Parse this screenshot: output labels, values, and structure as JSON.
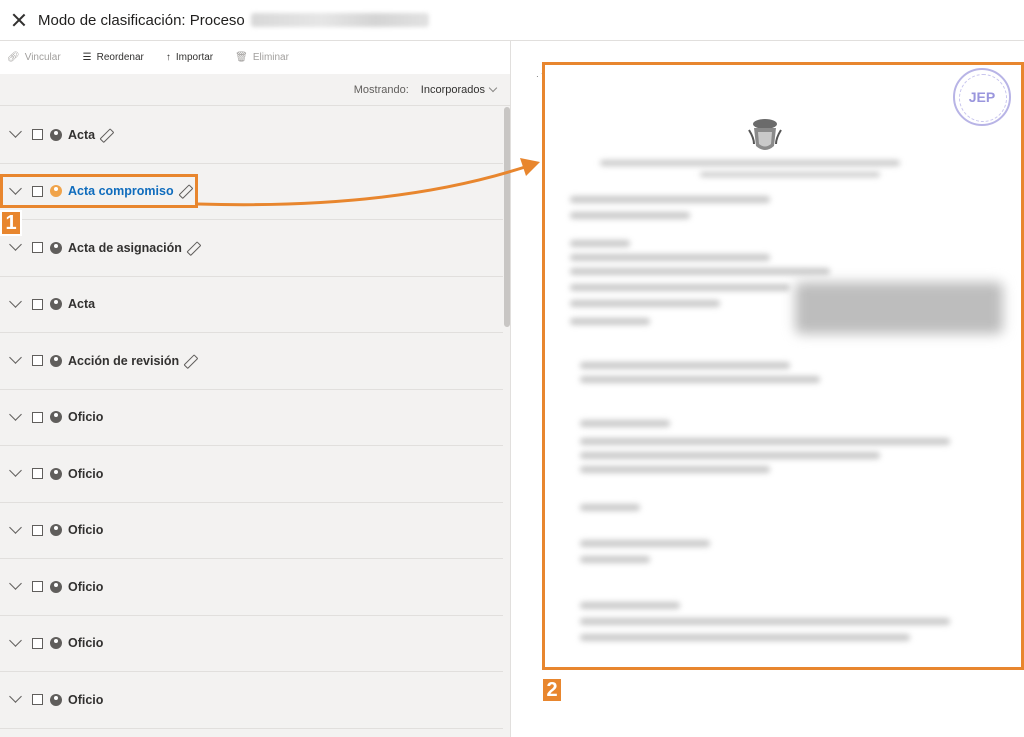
{
  "header": {
    "title": "Modo de clasificación: Proceso"
  },
  "toolbar": {
    "vincular": "Vincular",
    "reordenar": "Reordenar",
    "importar": "Importar",
    "eliminar": "Eliminar"
  },
  "filter": {
    "label": "Mostrando:",
    "value": "Incorporados"
  },
  "list": {
    "items": [
      {
        "label": "Acta"
      },
      {
        "label": "Acta compromiso"
      },
      {
        "label": "Acta de asignación"
      },
      {
        "label": "Acta"
      },
      {
        "label": "Acción de revisión"
      },
      {
        "label": "Oficio"
      },
      {
        "label": "Oficio"
      },
      {
        "label": "Oficio"
      },
      {
        "label": "Oficio"
      },
      {
        "label": "Oficio"
      },
      {
        "label": "Oficio"
      }
    ]
  },
  "preview": {
    "seal_text": "JEP"
  },
  "annotations": {
    "callout_1": "1",
    "callout_2": "2",
    "color": "#e8862e"
  },
  "colors": {
    "accent_blue": "#0f6cbd",
    "panel_gray": "#f3f2f1",
    "badge_orange": "#f0a34a"
  }
}
